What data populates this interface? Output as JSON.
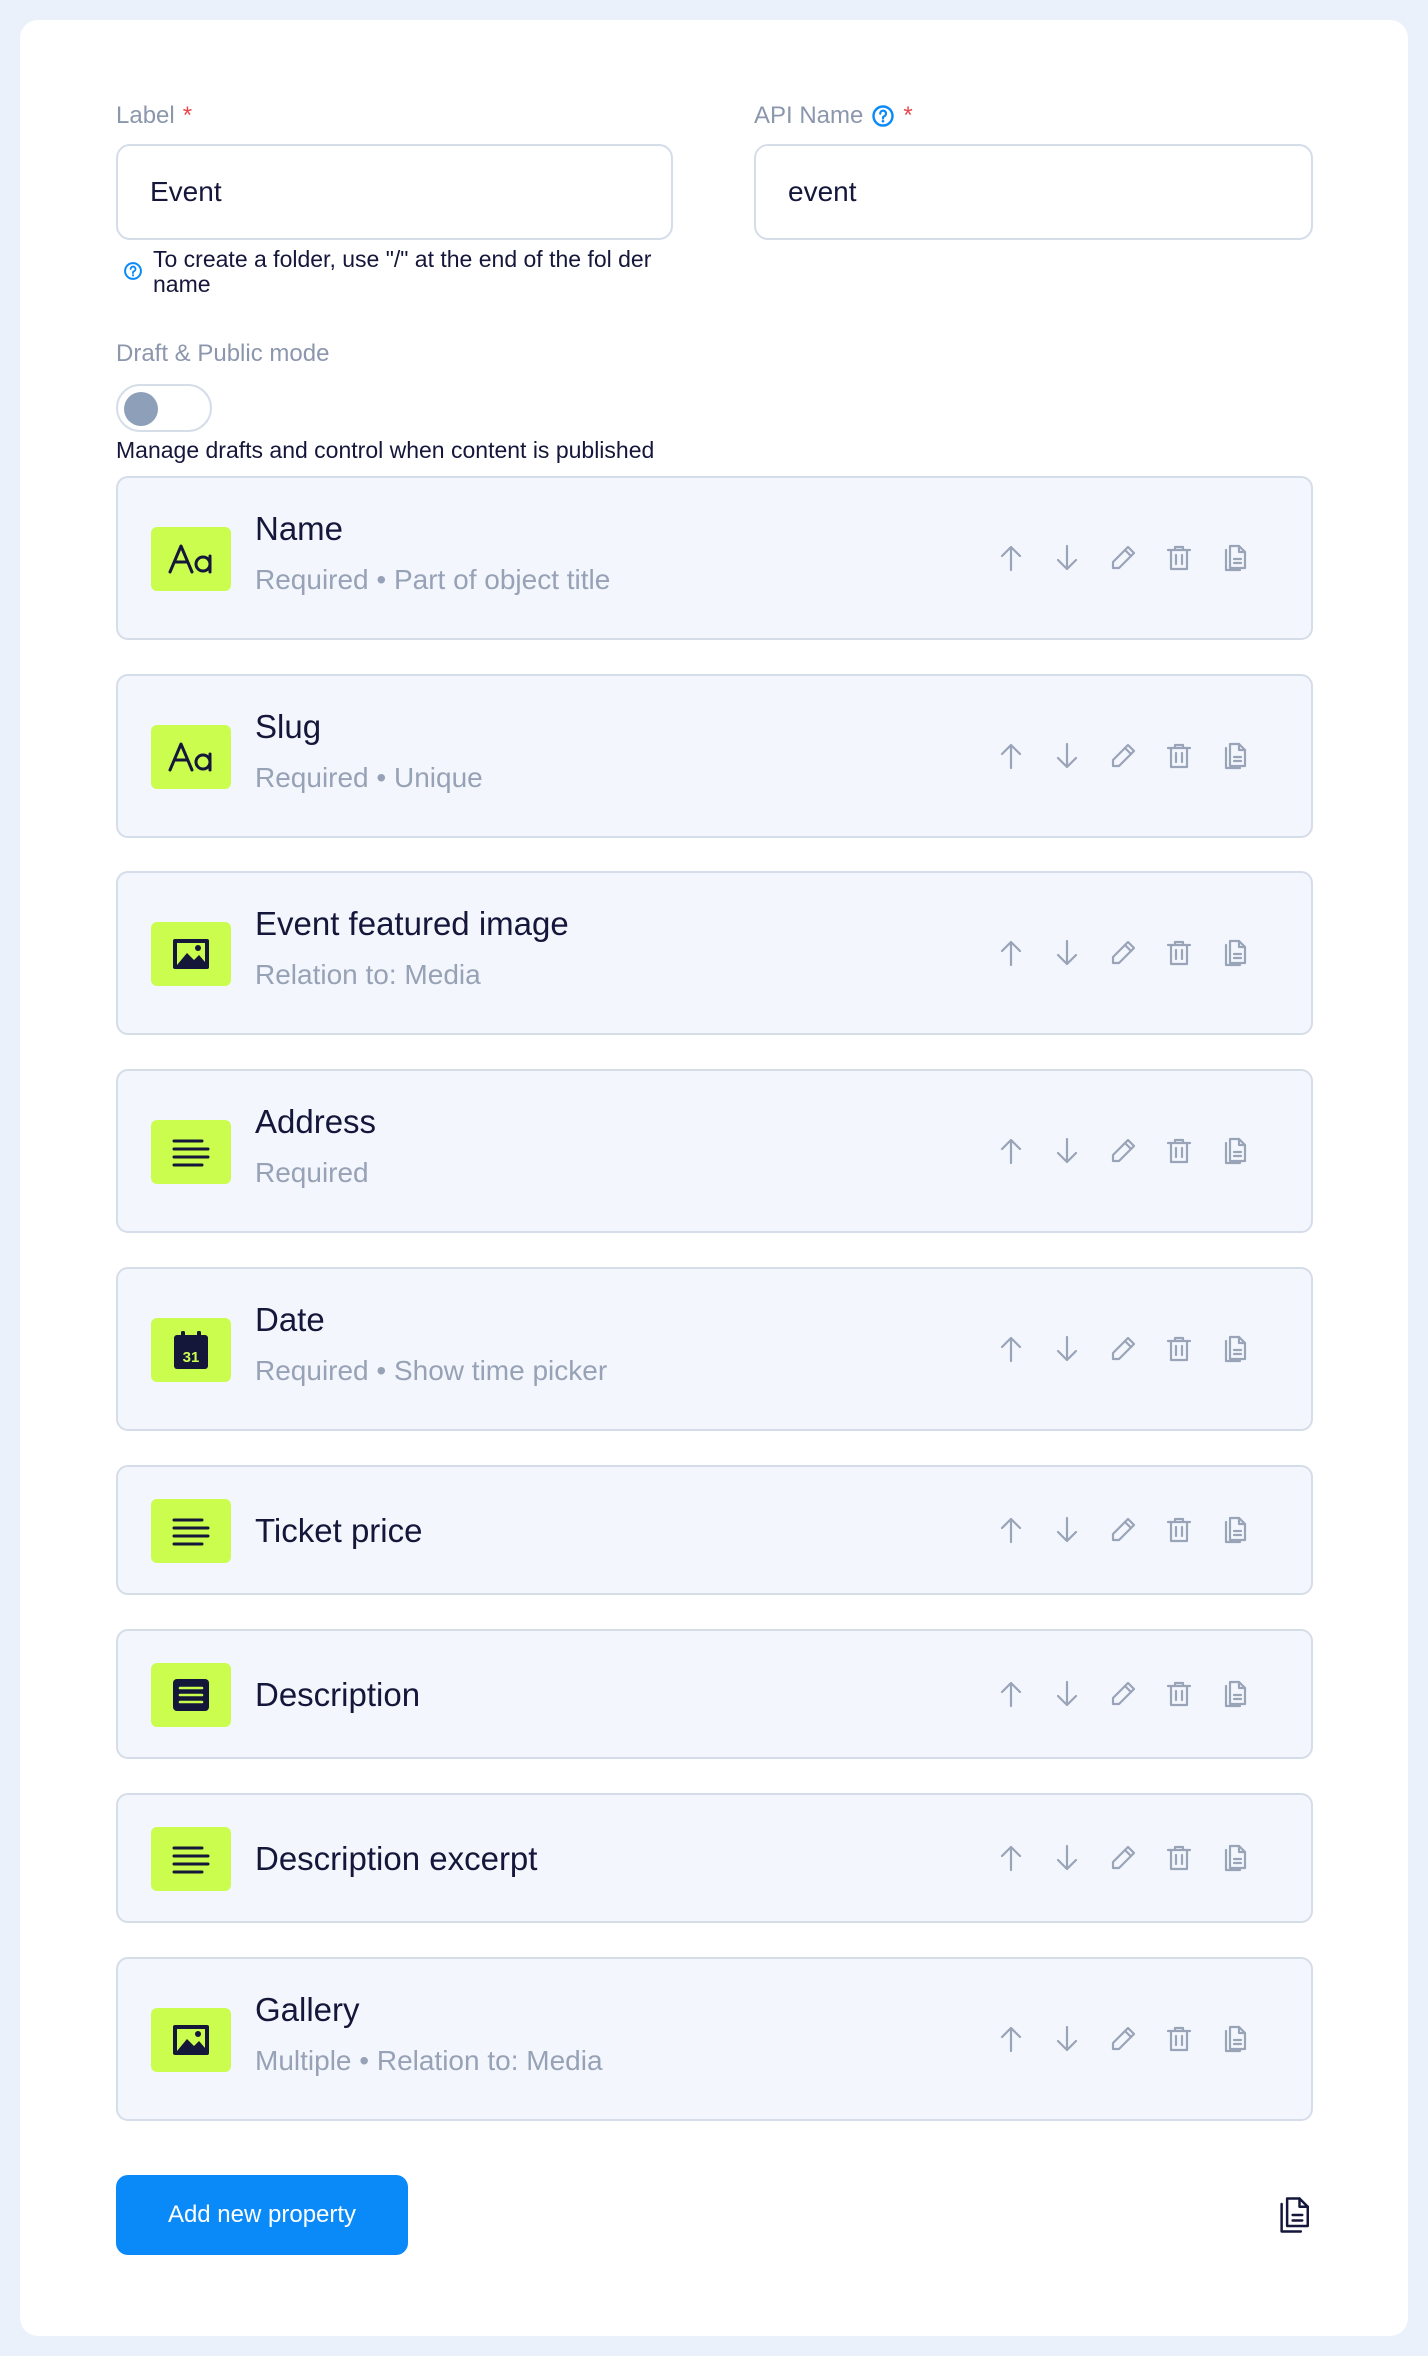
{
  "form": {
    "label_title": "Label",
    "label_required": "*",
    "label_value": "Event",
    "api_title": "API Name",
    "api_required": "*",
    "api_value": "event",
    "hint": "To create a folder, use \"/\" at the end of the fol der name",
    "toggle_title": "Draft & Public mode",
    "toggle_on": false,
    "toggle_desc": "Manage drafts and control when content is published"
  },
  "properties": [
    {
      "title": "Name",
      "sub": "Required • Part of object title",
      "icon": "text-type-icon"
    },
    {
      "title": "Slug",
      "sub": "Required • Unique",
      "icon": "text-type-icon"
    },
    {
      "title": "Event featured image",
      "sub": "Relation to: Media",
      "icon": "image-icon"
    },
    {
      "title": "Address",
      "sub": "Required",
      "icon": "paragraph-icon"
    },
    {
      "title": "Date",
      "sub": "Required • Show time picker",
      "icon": "calendar-icon"
    },
    {
      "title": "Ticket price",
      "sub": "",
      "icon": "paragraph-icon"
    },
    {
      "title": "Description",
      "sub": "",
      "icon": "rich-text-icon"
    },
    {
      "title": "Description excerpt",
      "sub": "",
      "icon": "paragraph-icon"
    },
    {
      "title": "Gallery",
      "sub": "Multiple • Relation to: Media",
      "icon": "image-icon"
    }
  ],
  "calendar_day": "31",
  "actions": [
    "move-up-icon",
    "move-down-icon",
    "edit-icon",
    "delete-icon",
    "duplicate-icon"
  ],
  "add_button": "Add new property",
  "colors": {
    "accent": "#0a8af8",
    "type_icon_bg": "#cbfd4f",
    "required": "#e5484d"
  }
}
